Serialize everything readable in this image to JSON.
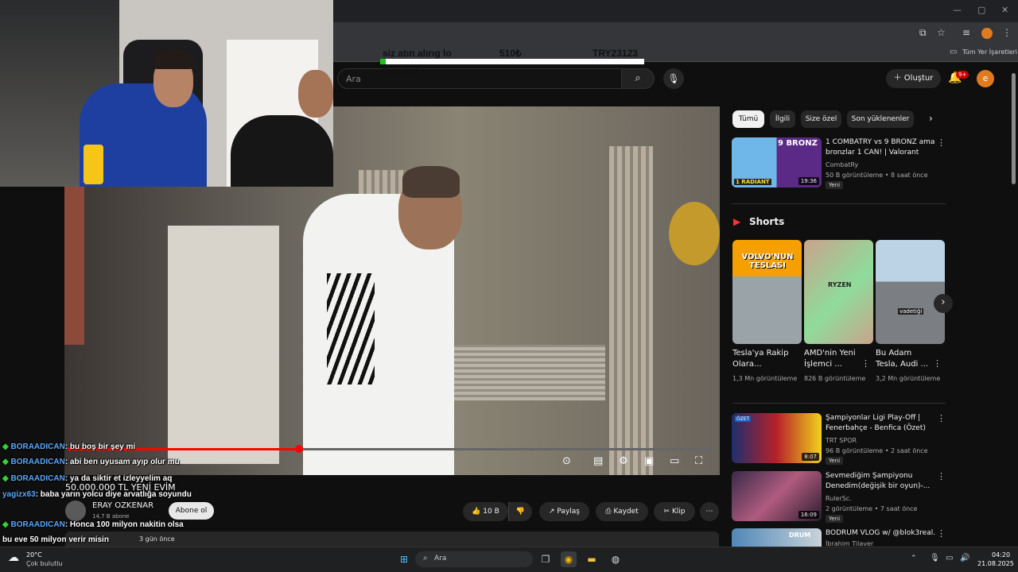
{
  "browser": {
    "bookmarks_label": "Tüm Yer İşaretleri"
  },
  "donation": {
    "line1": "siz atın alırıg lo",
    "line2": "bişeyler",
    "amount": "510₺",
    "goal": "TRY23123",
    "progress": 0.02
  },
  "header": {
    "search_placeholder": "Ara",
    "create_label": "Oluştur",
    "notif_count": "9+",
    "avatar_letter": "e"
  },
  "video": {
    "overlay_text": "50.000.000 TL YENİ EVİM",
    "progress": 0.36,
    "channel_name": "ERAY OZKENAR",
    "subscribers": "14,7 B abone",
    "subscribe_label": "Abone ol",
    "likes": "10 B",
    "share_label": "Paylaş",
    "save_label": "Kaydet",
    "clip_label": "Klip",
    "date_fragment": "3 gün önce"
  },
  "chat": [
    {
      "user": "BORAADICAN",
      "text": ": bu boş bir şey mi",
      "icon": true
    },
    {
      "user": "BORAADICAN",
      "text": ": abi ben uyusam ayıp olur mu",
      "icon": true
    },
    {
      "user": "BORAADICAN",
      "text": ": ya da siktir et izleyyelim aq",
      "icon": true
    },
    {
      "user": "yagizx63",
      "text": ": baba yarın yolcu diye arvatlığa soyundu",
      "icon": false
    },
    {
      "user": "BORAADICAN",
      "text": ": Honca 100 milyon nakitin olsa bu eve 50 milyon verir misin",
      "icon": true
    }
  ],
  "sidebar": {
    "chips": [
      "Tümü",
      "İlgili",
      "Size özel",
      "Son yüklenenler"
    ],
    "shorts_label": "Shorts",
    "videos": [
      {
        "title": "1 COMBATRY vs 9 BRONZ ama bronzlar 1 CAN! | Valorant",
        "channel": "CombatRy",
        "meta": "50 B görüntüleme • 8 saat önce",
        "badge": "Yeni",
        "duration": "19:36",
        "thumb_text": "9 BRONZ",
        "thumb_sub": "1 RADIANT"
      },
      {
        "title": "Şampiyonlar Ligi Play-Off | Fenerbahçe - Benfica (Özet)",
        "channel": "TRT SPOR",
        "meta": "96 B görüntüleme • 2 saat önce",
        "badge": "Yeni",
        "duration": "8:07",
        "thumb_text": "ÖZET"
      },
      {
        "title": "Sevmediğim Şampiyonu Denedim(değişik bir oyun)-...",
        "channel": "RulerSc.",
        "meta": "2 görüntüleme • 7 saat önce",
        "badge": "Yeni",
        "duration": "16:09"
      },
      {
        "title": "BODRUM VLOG w/ @blok3real.",
        "channel": "İbrahim Tilaver",
        "meta": "",
        "badge": "",
        "duration": "",
        "thumb_text": "DRUM"
      }
    ],
    "shorts": [
      {
        "title": "Tesla'ya Rakip Olara...",
        "views": "1,3 Mn görüntüleme",
        "thumb_text": "VOLVO'NUN TESLASI"
      },
      {
        "title": "AMD'nin Yeni İşlemci ...",
        "views": "826 B görüntüleme",
        "thumb_text": "RYZEN"
      },
      {
        "title": "Bu Adam Tesla, Audi ...",
        "views": "3,2 Mn görüntüleme",
        "thumb_text": "vadetiği"
      }
    ]
  },
  "taskbar": {
    "temp": "20°C",
    "weather": "Çok bulutlu",
    "search_label": "Ara",
    "time": "04:20",
    "date": "21.08.2025"
  }
}
